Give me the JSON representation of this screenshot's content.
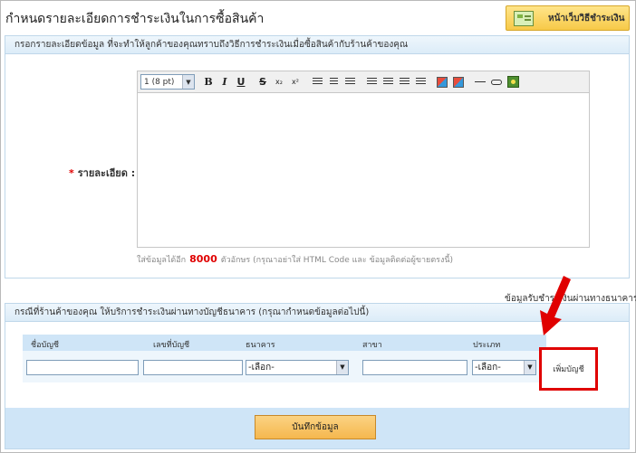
{
  "header": {
    "title": "กำหนดรายละเอียดการชำระเงินในการซื้อสินค้า",
    "payment_page_button": "หน้าเว็บวิธีชำระเงิน"
  },
  "details_panel": {
    "heading": "กรอกรายละเอียดข้อมูล ที่จะทำให้ลูกค้าของคุณทราบถึงวิธีการชำระเงินเมื่อซื้อสินค้ากับร้านค้าของคุณ",
    "required_mark": "*",
    "label": "รายละเอียด :",
    "editor": {
      "font_size": "1 (8 pt)",
      "bold": "B",
      "italic": "I",
      "underline": "U",
      "strike": "S",
      "subscript": "x₂",
      "superscript": "x²"
    },
    "hint_before": "ใส่ข้อมูลได้อีก",
    "hint_count": "8000",
    "hint_after": "ตัวอักษร (กรุณาอย่าใส่ HTML Code และ ข้อมูลติดต่อผู้ขายตรงนี้)"
  },
  "bank_link_caption": "ข้อมูลรับชำระเงินผ่านทางธนาคาร",
  "bank_panel": {
    "heading": "กรณีที่ร้านค้าของคุณ ให้บริการชำระเงินผ่านทางบัญชีธนาคาร (กรุณากำหนดข้อมูลต่อไปนี้)",
    "columns": [
      "ชื่อบัญชี",
      "เลขที่บัญชี",
      "ธนาคาร",
      "สาขา",
      "ประเภท"
    ],
    "bank_select": "-เลือก-",
    "type_select": "-เลือก-",
    "add_account": "เพิ่มบัญชี",
    "save_button": "บันทึกข้อมูล"
  },
  "colors": {
    "highlight": "#e00000",
    "panel_header": "#dcecf8",
    "button": "#f5b74e"
  }
}
